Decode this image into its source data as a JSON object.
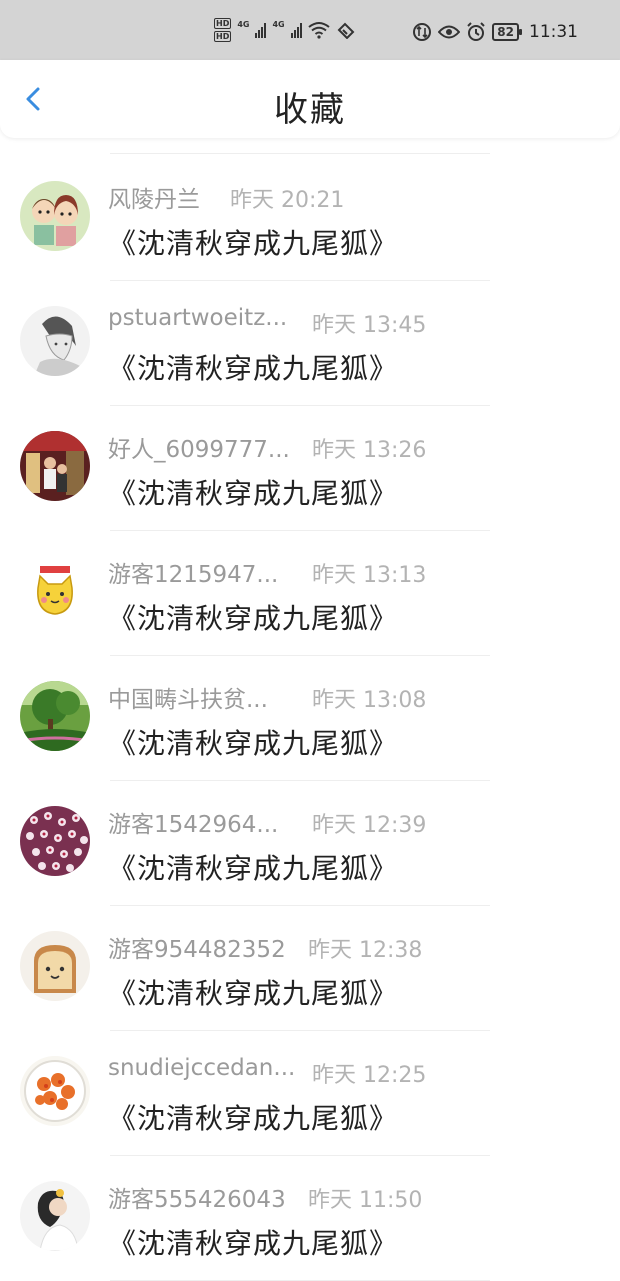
{
  "status_bar": {
    "hd1": "HD",
    "hd2": "HD",
    "net1": "4G",
    "net2": "4G",
    "battery": "82",
    "time": "11:31",
    "icons": [
      "data-sync-icon",
      "eye-icon",
      "alarm-icon"
    ]
  },
  "header": {
    "title": "收藏",
    "back_icon": "chevron-left-icon",
    "accent": "#3a8de0"
  },
  "items": [
    {
      "name": "风陵丹兰",
      "time": "昨天 20:21",
      "title": "《沈清秋穿成九尾狐》",
      "avatar": "anime-girls"
    },
    {
      "name": "pstuartwoeitz...",
      "time": "昨天 13:45",
      "title": "《沈清秋穿成九尾狐》",
      "avatar": "sketch-boy"
    },
    {
      "name": "好人_6099777...",
      "time": "昨天 13:26",
      "title": "《沈清秋穿成九尾狐》",
      "avatar": "people-indoor"
    },
    {
      "name": "游客1215947...",
      "time": "昨天 13:13",
      "title": "《沈清秋穿成九尾狐》",
      "avatar": "yellow-cat"
    },
    {
      "name": "中国畴斗扶贫...",
      "time": "昨天 13:08",
      "title": "《沈清秋穿成九尾狐》",
      "avatar": "green-tree"
    },
    {
      "name": "游客1542964...",
      "time": "昨天 12:39",
      "title": "《沈清秋穿成九尾狐》",
      "avatar": "pink-flowers"
    },
    {
      "name": "游客954482352",
      "time": "昨天 12:38",
      "title": "《沈清秋穿成九尾狐》",
      "avatar": "toast"
    },
    {
      "name": "snudiejccedan...",
      "time": "昨天 12:25",
      "title": "《沈清秋穿成九尾狐》",
      "avatar": "food-bowl"
    },
    {
      "name": "游客555426043",
      "time": "昨天 11:50",
      "title": "《沈清秋穿成九尾狐》",
      "avatar": "girl-white"
    }
  ]
}
